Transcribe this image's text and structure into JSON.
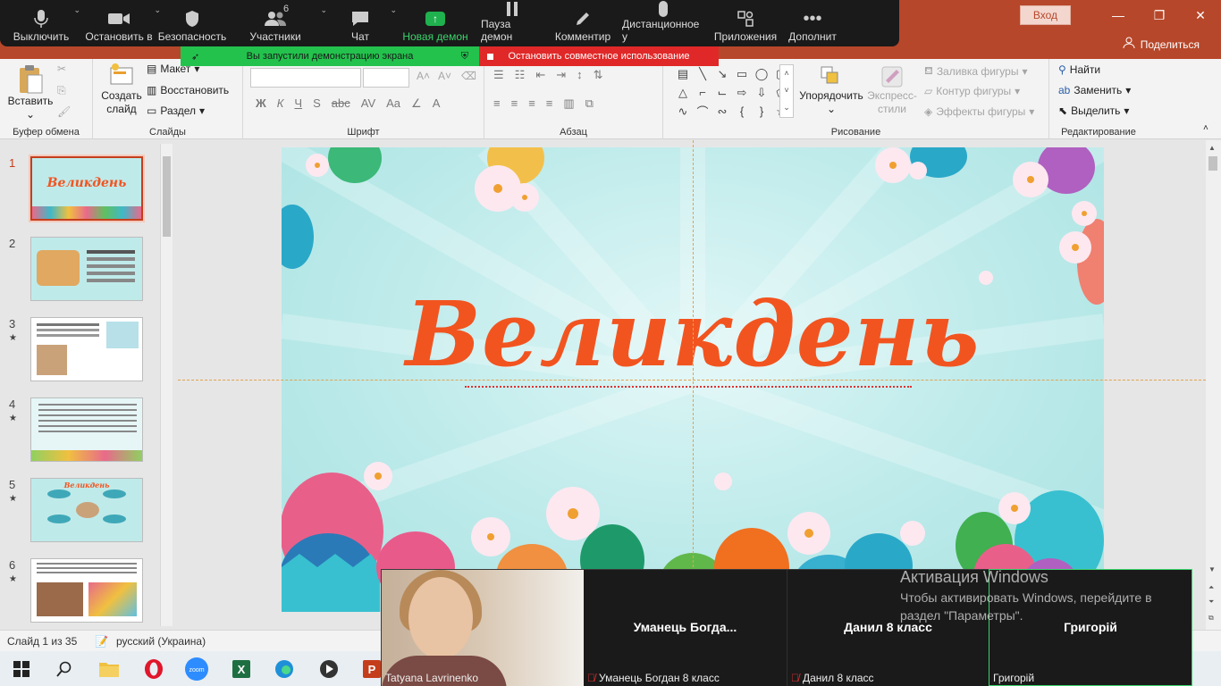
{
  "titlebar": {
    "login_label": "Вход",
    "share_label": "Поделиться",
    "minimize": "—",
    "restore": "❐",
    "close": "✕"
  },
  "zoom_toolbar": {
    "items": [
      {
        "label": "Выключить",
        "icon": "microphone-icon"
      },
      {
        "label": "Остановить в",
        "icon": "video-camera-icon"
      },
      {
        "label": "Безопасность",
        "icon": "shield-icon"
      },
      {
        "label": "Участники",
        "icon": "participants-icon",
        "count": "6"
      },
      {
        "label": "Чат",
        "icon": "chat-icon"
      },
      {
        "label": "Новая демон",
        "icon": "share-screen-icon"
      },
      {
        "label": "Пауза демон",
        "icon": "pause-icon"
      },
      {
        "label": "Комментир",
        "icon": "pencil-icon"
      },
      {
        "label": "Дистанционное у",
        "icon": "mouse-icon"
      },
      {
        "label": "Приложения",
        "icon": "apps-icon"
      },
      {
        "label": "Дополнит",
        "icon": "more-icon"
      }
    ],
    "share_banner": "Вы запустили демонстрацию экрана",
    "stop_banner": "Остановить совместное использование"
  },
  "ribbon": {
    "clipboard": {
      "label": "Буфер обмена",
      "paste": "Вставить"
    },
    "slides": {
      "label": "Слайды",
      "create": "Создать слайд",
      "layout": "Макет",
      "reset": "Восстановить",
      "section": "Раздел"
    },
    "font": {
      "label": "Шрифт"
    },
    "paragraph": {
      "label": "Абзац"
    },
    "drawing": {
      "label": "Рисование",
      "arrange": "Упорядочить",
      "quick_styles": "Экспресс-стили",
      "fill": "Заливка фигуры",
      "outline": "Контур фигуры",
      "effects": "Эффекты фигуры"
    },
    "editing": {
      "label": "Редактирование",
      "find": "Найти",
      "replace": "Заменить",
      "select": "Выделить"
    }
  },
  "slides_panel": {
    "items": [
      {
        "num": "1",
        "star": false,
        "active": true
      },
      {
        "num": "2",
        "star": false,
        "active": false
      },
      {
        "num": "3",
        "star": true,
        "active": false
      },
      {
        "num": "4",
        "star": true,
        "active": false
      },
      {
        "num": "5",
        "star": true,
        "active": false
      },
      {
        "num": "6",
        "star": true,
        "active": false
      }
    ],
    "thumb1_title": "Великдень",
    "thumb5_title": "Великдень"
  },
  "slide": {
    "title": "Великдень"
  },
  "statusbar": {
    "slide_info": "Слайд 1 из 35",
    "language": "русский (Украина)"
  },
  "video": {
    "tiles": [
      {
        "name": "",
        "caption": "Tatyana Lavrinenko",
        "muted": false
      },
      {
        "name": "Уманець Богда...",
        "caption": "Уманець Богдан 8 класс",
        "muted": true
      },
      {
        "name": "Данил 8 класс",
        "caption": "Данил 8 класс",
        "muted": true
      },
      {
        "name": "Григорій",
        "caption": "Григорій",
        "muted": false
      }
    ]
  },
  "watermark": {
    "title": "Активация Windows",
    "text": "Чтобы активировать Windows, перейдите в раздел \"Параметры\"."
  },
  "colors": {
    "accent": "#b7472a",
    "zoom_green": "#23c24d",
    "zoom_red": "#e02828",
    "slide_title": "#f25420"
  }
}
